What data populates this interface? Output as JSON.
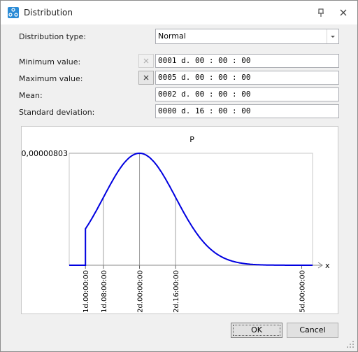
{
  "window": {
    "title": "Distribution",
    "icon": "distribution-app-icon"
  },
  "form": {
    "distribution_type_label": "Distribution type:",
    "distribution_type_value": "Normal",
    "minimum_label": "Minimum value:",
    "minimum_value": "0001 d. 00 : 00 : 00",
    "maximum_label": "Maximum value:",
    "maximum_value": "0005 d. 00 : 00 : 00",
    "mean_label": "Mean:",
    "mean_value": "0002 d. 00 : 00 : 00",
    "std_label": "Standard deviation:",
    "std_value": "0000 d. 16 : 00 : 00"
  },
  "chart_data": {
    "type": "line",
    "title": "P",
    "xlabel": "x",
    "ylabel": "",
    "y_max_label": "0,00000803",
    "x_ticks": [
      "1d.00:00:00",
      "1d.08:00:00",
      "2d.00:00:00",
      "2d.16:00:00",
      "5d.00:00:00"
    ],
    "x_tick_days": [
      1.0,
      1.3333,
      2.0,
      2.6667,
      5.0
    ],
    "xlim_days": [
      0.7,
      5.2
    ],
    "distribution": {
      "kind": "normal",
      "mean_days": 2.0,
      "std_days": 0.6667,
      "min_days": 1.0,
      "max_days": 5.0
    },
    "line_color": "#0000e0"
  },
  "buttons": {
    "ok": "OK",
    "cancel": "Cancel"
  }
}
